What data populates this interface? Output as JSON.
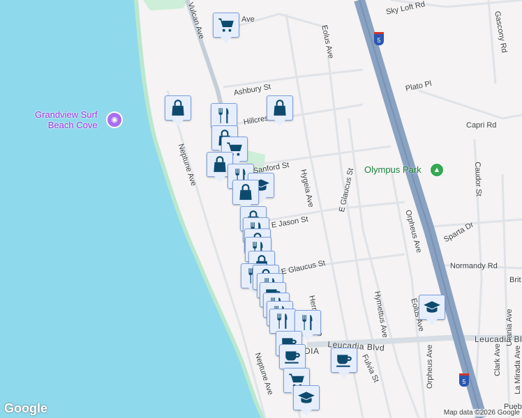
{
  "map": {
    "water_color": "#8ed9ec",
    "land_color": "#f5f3f3",
    "marker_icon_color": "#0e4a6e",
    "streets": [
      "Vulcan Ave",
      "Ave",
      "Sky Loft Rd",
      "Gascony Rd",
      "Eolus Ave",
      "Ashbury St",
      "Plato Pl",
      "Hillcrest",
      "Capri Rd",
      "Sanford St",
      "Hygeia Ave",
      "Caudor St",
      "Neptune Ave",
      "E Jason St",
      "E Glaucus St",
      "Orpheus Ave",
      "Sparta Dr",
      "Normandy Rd",
      "Brit",
      "Hermes Ave",
      "Hymettus Ave",
      "Eolus Ave",
      "Urania Ave",
      "Leucadia Blvd",
      "Leucadia Blvd",
      "Fulvia St",
      "Vulcan Ave",
      "Orpheus Ave",
      "Clark Ave",
      "La Mirada Ave",
      "Neptune Ave",
      "Puebl"
    ],
    "area_label": "DIA",
    "poi": {
      "name_line1": "Grandview Surf",
      "name_line2": "Beach Cove",
      "icon": "camera-icon"
    },
    "park": {
      "name": "Olympus Park",
      "icon": "tree-icon"
    },
    "highway_shield": "5",
    "logo": "Google",
    "attribution": "Map data ©2026 Google"
  },
  "markers": [
    {
      "type": "cart"
    },
    {
      "type": "bag"
    },
    {
      "type": "bag"
    },
    {
      "type": "food"
    },
    {
      "type": "bag"
    },
    {
      "type": "cart"
    },
    {
      "type": "bag"
    },
    {
      "type": "food"
    },
    {
      "type": "school"
    },
    {
      "type": "bag"
    },
    {
      "type": "bag"
    },
    {
      "type": "food"
    },
    {
      "type": "bag"
    },
    {
      "type": "food"
    },
    {
      "type": "bag"
    },
    {
      "type": "food"
    },
    {
      "type": "bag"
    },
    {
      "type": "food"
    },
    {
      "type": "coffee"
    },
    {
      "type": "food"
    },
    {
      "type": "food"
    },
    {
      "type": "food"
    },
    {
      "type": "food"
    },
    {
      "type": "coffee"
    },
    {
      "type": "coffee"
    },
    {
      "type": "cart"
    },
    {
      "type": "school"
    },
    {
      "type": "coffee"
    },
    {
      "type": "school"
    }
  ]
}
